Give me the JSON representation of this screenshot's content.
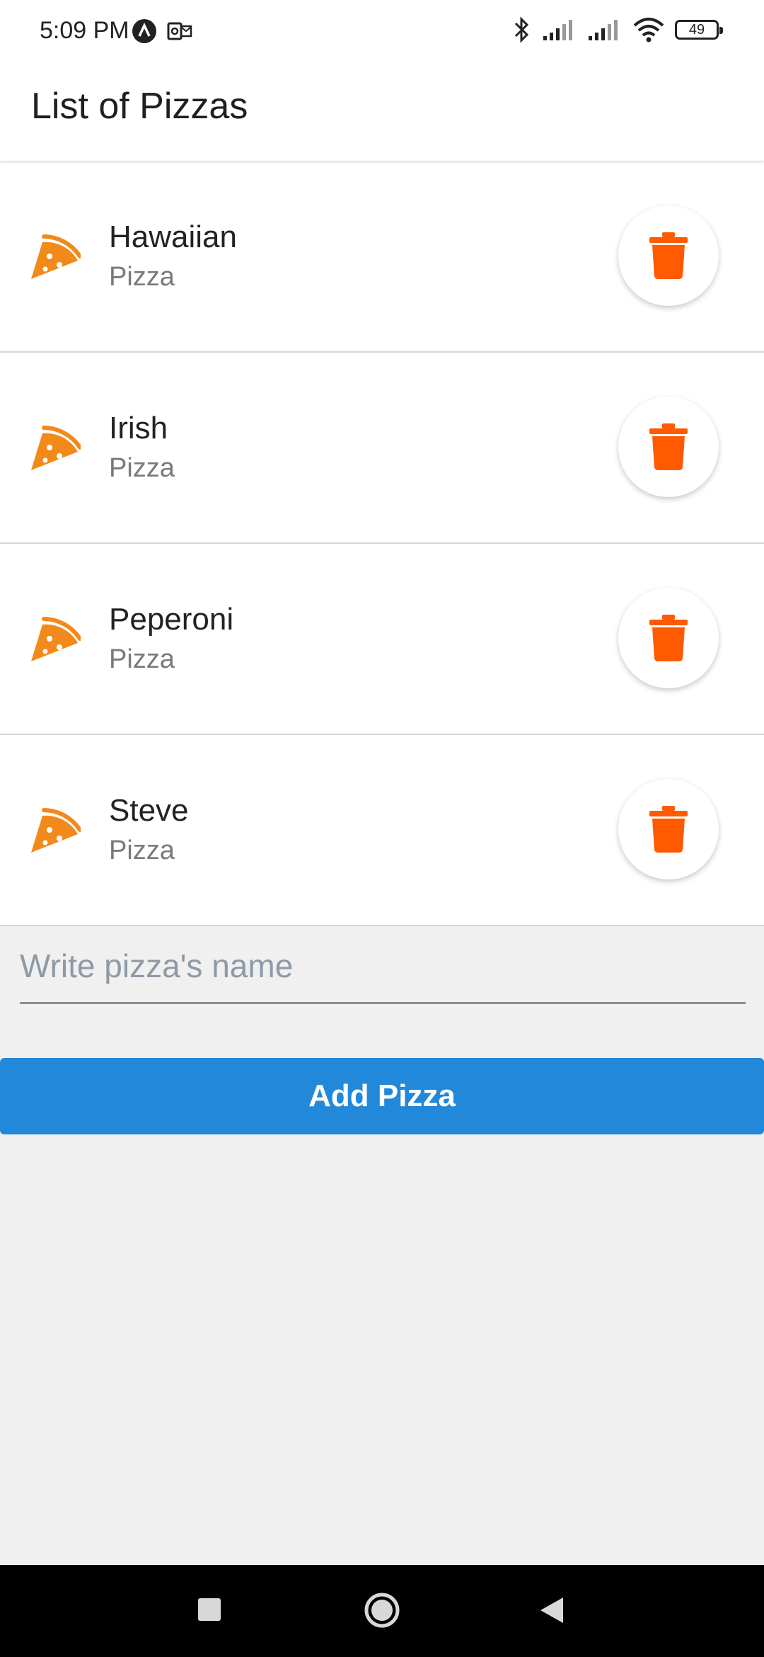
{
  "status_bar": {
    "time": "5:09 PM",
    "battery_level": "49",
    "icons": [
      "app-notification-icon",
      "outlook-icon",
      "bluetooth-icon",
      "signal-icon",
      "signal-icon",
      "wifi-icon",
      "battery-icon"
    ]
  },
  "app_bar": {
    "title": "List of Pizzas"
  },
  "pizzas": [
    {
      "name": "Hawaiian",
      "subtitle": "Pizza"
    },
    {
      "name": "Irish",
      "subtitle": "Pizza"
    },
    {
      "name": "Peperoni",
      "subtitle": "Pizza"
    },
    {
      "name": "Steve",
      "subtitle": "Pizza"
    }
  ],
  "input": {
    "placeholder": "Write pizza's name",
    "value": ""
  },
  "add_button": {
    "label": "Add Pizza"
  },
  "colors": {
    "pizza_icon": "#f28a1b",
    "delete_icon": "#ff5a00",
    "primary_button": "#2188da"
  }
}
